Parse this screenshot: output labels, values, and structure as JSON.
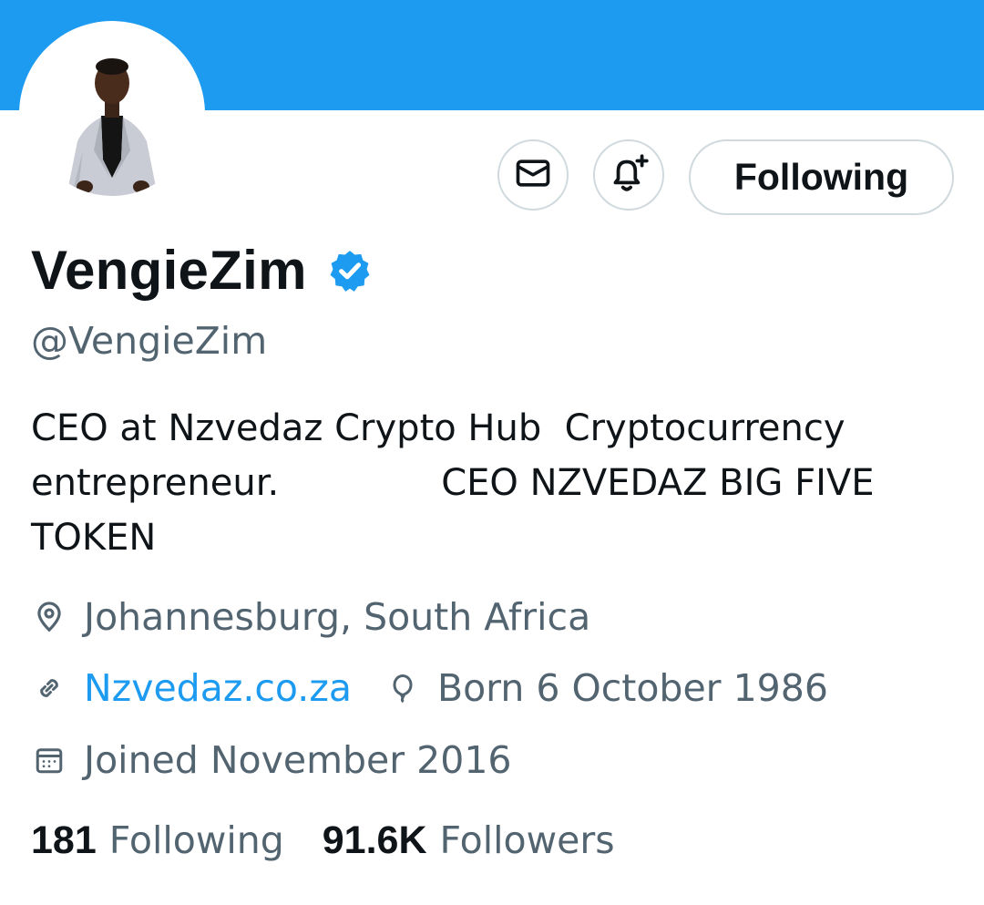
{
  "colors": {
    "banner": "#1d9bf0",
    "verified": "#1d9bf0",
    "link": "#1d9bf0",
    "secondary_text": "#536471"
  },
  "profile": {
    "display_name": "VengieZim",
    "handle": "@VengieZim",
    "bio_line1": "CEO at Nzvedaz Crypto Hub  Cryptocurrency",
    "bio_line2": "entrepreneur.              CEO NZVEDAZ BIG FIVE",
    "bio_line3": "TOKEN",
    "location": "Johannesburg, South Africa",
    "website": "Nzvedaz.co.za",
    "birthday": "Born 6 October 1986",
    "joined": "Joined November 2016"
  },
  "actions": {
    "message_icon": "envelope-icon",
    "notify_icon": "bell-plus-icon",
    "follow_label": "Following"
  },
  "stats": {
    "following_count": "181",
    "following_label": "Following",
    "followers_count": "91.6K",
    "followers_label": "Followers"
  }
}
